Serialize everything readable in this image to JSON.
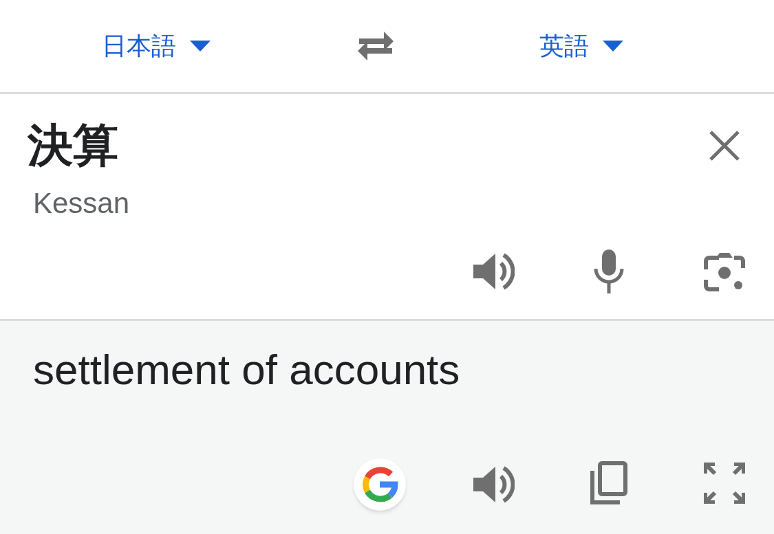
{
  "language_bar": {
    "source": {
      "label": "日本語"
    },
    "target": {
      "label": "英語"
    }
  },
  "input": {
    "text": "決算",
    "romanization": "Kessan"
  },
  "output": {
    "text": "settlement of accounts"
  }
}
